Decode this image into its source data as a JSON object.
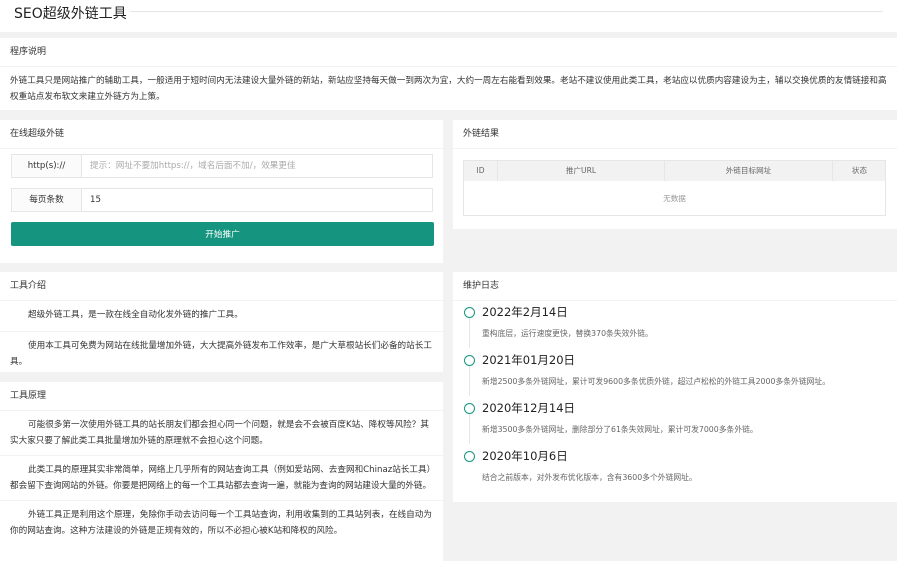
{
  "app": {
    "title": "SEO超级外链工具"
  },
  "intro": {
    "header": "程序说明",
    "text": "外链工具只是网站推广的辅助工具，一般适用于短时间内无法建设大量外链的新站，新站应坚持每天做一到两次为宜，大约一周左右能看到效果。老站不建议使用此类工具，老站应以优质内容建设为主，辅以交换优质的友情链接和高权重站点发布软文来建立外链方为上策。"
  },
  "online": {
    "header": "在线超级外链",
    "url_label": "http(s)://",
    "url_placeholder": "提示：网址不要加https://，域名后面不加/，效果更佳",
    "url_value": "",
    "count_label": "每页条数",
    "count_value": "15",
    "start_button": "开始推广"
  },
  "result": {
    "header": "外链结果",
    "columns": [
      "ID",
      "推广URL",
      "外链目标网址",
      "状态"
    ],
    "empty_text": "无数据"
  },
  "tool_intro": {
    "header": "工具介绍",
    "paragraphs": [
      "超级外链工具，是一款在线全自动化发外链的推广工具。",
      "使用本工具可免费为网站在线批量增加外链，大大提高外链发布工作效率，是广大草根站长们必备的站长工具。"
    ]
  },
  "principle": {
    "header": "工具原理",
    "paragraphs": [
      "可能很多第一次使用外链工具的站长朋友们都会担心同一个问题，就是会不会被百度K站、降权等风险？其实大家只要了解此类工具批量增加外链的原理就不会担心这个问题。",
      "此类工具的原理其实非常简单，网络上几乎所有的网站查询工具（例如爱站网、去查网和Chinaz站长工具）都会留下查询网站的外链。你要是把网络上的每一个工具站都去查询一遍，就能为查询的网站建设大量的外链。",
      "外链工具正是利用这个原理，免除你手动去访问每一个工具站查询，利用收集到的工具站列表，在线自动为你的网站查询。这种方法建设的外链是正规有效的，所以不必担心被K站和降权的风险。"
    ]
  },
  "log": {
    "header": "维护日志",
    "entries": [
      {
        "date": "2022年2月14日",
        "desc": "重构底层，运行速度更快，替换370条失效外链。"
      },
      {
        "date": "2021年01月20日",
        "desc": "新增2500多条外链网址，累计可发9600多条优质外链，超过卢松松的外链工具2000多条外链网址。"
      },
      {
        "date": "2020年12月14日",
        "desc": "新增3500多条外链网址，删除部分了61条失效网址，累计可发7000多条外链。"
      },
      {
        "date": "2020年10月6日",
        "desc": "结合之前版本，对外发布优化版本，含有3600多个外链网址。"
      }
    ]
  },
  "colors": {
    "accent": "#159580",
    "background": "#f2f2f2",
    "card": "#ffffff"
  }
}
